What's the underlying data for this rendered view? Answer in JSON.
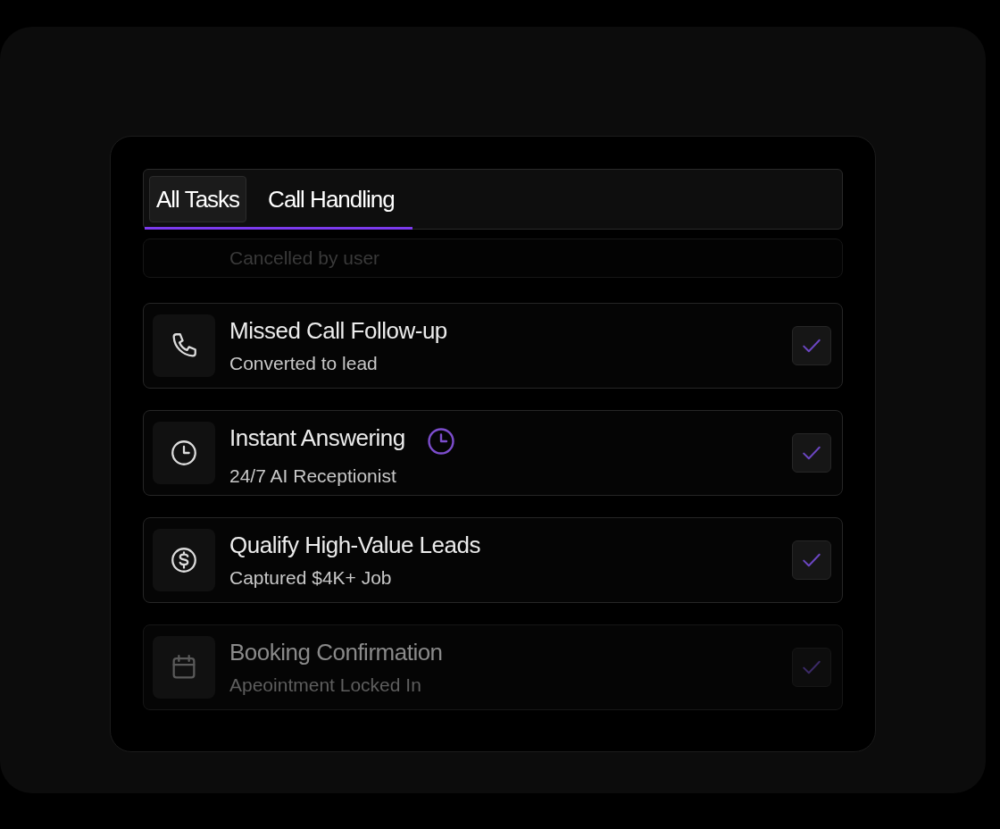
{
  "tabs": [
    {
      "label": "All Tasks",
      "selected": true
    },
    {
      "label": "Call Handling",
      "selected": false
    }
  ],
  "tasks": [
    {
      "subtitle": "Cancelled by user"
    },
    {
      "kind": "phone",
      "title": "Missed Call Follow-up",
      "subtitle": "Converted to lead",
      "scheduled": false,
      "checked": true
    },
    {
      "kind": "clock",
      "title": "Instant Answering",
      "subtitle": "24/7 AI Receptionist",
      "scheduled": true,
      "checked": true
    },
    {
      "kind": "dollar",
      "title": "Qualify High-Value Leads",
      "subtitle": "Captured $4K+ Job",
      "scheduled": false,
      "checked": true
    },
    {
      "kind": "calendar",
      "title": "Booking Confirmation",
      "subtitle": "Apeointment Locked In",
      "scheduled": false,
      "checked": true
    }
  ]
}
